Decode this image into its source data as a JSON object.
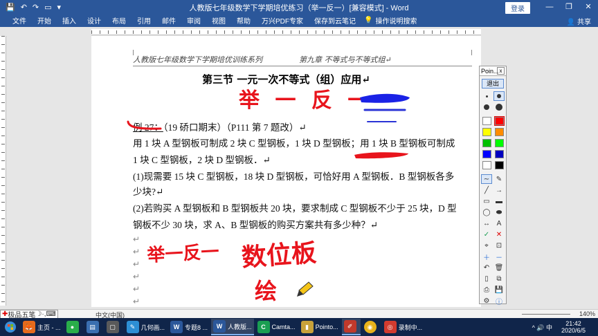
{
  "window": {
    "title": "人教版七年级数学下学期培优练习（举一反一）[兼容模式] - Word",
    "login_label": "登录",
    "controls": [
      "—",
      "❐",
      "✕"
    ]
  },
  "quick_access": [
    "💾",
    "↶",
    "↷",
    "▭",
    "▾"
  ],
  "ribbon": {
    "tabs": [
      "文件",
      "开始",
      "插入",
      "设计",
      "布局",
      "引用",
      "邮件",
      "审阅",
      "视图",
      "帮助",
      "万兴PDF专家",
      "保存到云笔记"
    ],
    "tell_me": "操作说明搜索",
    "share": "共享"
  },
  "document": {
    "header_left": "人教版七年级数学下学期培优训练系列",
    "header_right": "第九章  不等式与不等式组↵",
    "section_title": "第三节    一元一次不等式（组）应用↵",
    "example_label": "例 27：",
    "example_source": "（19 硚口期末）（P111 第 7 题改）↵",
    "line1": "用 1 块 A 型钢板可制成 2 块 C 型钢板，1 块 D 型钢板；用 1 块 B 型钢板可制成",
    "line2": "1 块 C 型钢板，2 块 D 型钢板．↵",
    "q1_line1": "(1)现需要 15 块 C 型钢板，18 块 D 型钢板，可恰好用 A 型钢板．B 型钢板各多",
    "q1_line2": "少块?↵",
    "q2_line1": "(2)若购买 A 型钢板和 B 型钢板共 20 块，要求制成 C 型钢板不少于 25 块，D 型",
    "q2_line2": "钢板不少 30 块，求 A、B 型钢板的购买方案共有多少种？↵",
    "para_marks": [
      "↵",
      "↵",
      "↵",
      "↵",
      "↵",
      "↵"
    ]
  },
  "annotations": {
    "top_handwriting": "举 一 反 一",
    "bottom_handwriting_1": "举一反一",
    "bottom_handwriting_2": "数位板",
    "bottom_handwriting_3": "绘"
  },
  "pointofix": {
    "title": "Poin...",
    "close": "x",
    "exit_label": "退出",
    "colors": [
      "#ffffff",
      "#ff0000",
      "#ffff00",
      "#ff8c00",
      "#00c000",
      "#00ff00",
      "#0000ff",
      "#0000c0",
      "#ffffff",
      "#000000"
    ],
    "tool_letter": "A"
  },
  "statusbar": {
    "ime_label": "极品五笔",
    "language": "中文(中国)",
    "zoom": "140%"
  },
  "taskbar": {
    "items": [
      {
        "label": "主页 - ...",
        "color": "#e56a1c"
      },
      {
        "label": "",
        "color": "#2aae4a"
      },
      {
        "label": "",
        "color": "#3a6fb0"
      },
      {
        "label": "",
        "color": "#5a5a5a"
      },
      {
        "label": "几何画...",
        "color": "#2d8fd5"
      },
      {
        "label": "专题8 ...",
        "color": "#2b579a"
      },
      {
        "label": "人教版...",
        "color": "#2b579a"
      },
      {
        "label": "Camta...",
        "color": "#1a9e52"
      },
      {
        "label": "Pointo...",
        "color": "#c8a23a"
      },
      {
        "label": "",
        "color": "#c0392b"
      },
      {
        "label": "",
        "color": "#e8b21b"
      },
      {
        "label": "录制中...",
        "color": "#d23b2f"
      }
    ],
    "tray": "^ 🔊 中",
    "time": "21:42",
    "date": "2020/6/5"
  }
}
